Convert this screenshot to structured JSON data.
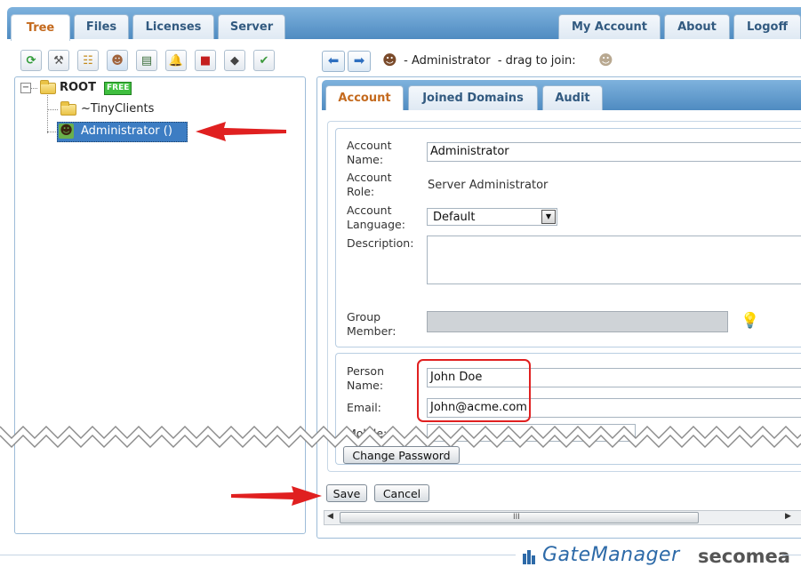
{
  "top_tabs": [
    "Tree",
    "Files",
    "Licenses",
    "Server"
  ],
  "account_tabs": [
    "My Account",
    "About",
    "Logoff"
  ],
  "toolbar_icons": [
    "refresh-icon",
    "wrench-icon",
    "hierarchy-icon",
    "user-icon",
    "certificate-icon",
    "bell-icon",
    "toolbox-icon",
    "eraser-icon",
    "check-icon"
  ],
  "tree": {
    "root_label": "ROOT",
    "root_badge": "FREE",
    "child_folder": "~TinyClients",
    "selected_item": "Administrator ()"
  },
  "breadcrumb": {
    "text": " - Administrator  - drag to join:"
  },
  "sub_tabs": [
    "Account",
    "Joined Domains",
    "Audit"
  ],
  "form": {
    "account_name_label": "Account Name:",
    "account_name_value": "Administrator",
    "account_role_label": "Account Role:",
    "account_role_value": "Server Administrator",
    "account_language_label": "Account Language:",
    "account_language_value": "Default",
    "description_label": "Description:",
    "description_value": "",
    "group_member_label": "Group Member:",
    "person_name_label": "Person Name:",
    "person_name_value": "John Doe",
    "email_label": "Email:",
    "email_value": "John@acme.com",
    "mobile_label": "Mobile:"
  },
  "buttons": {
    "change_password": "Change Password",
    "save": "Save",
    "cancel": "Cancel"
  },
  "scrollbar_grip": "III",
  "footer": {
    "brand": "GateManager",
    "company": "secomea"
  },
  "colors": {
    "header_blue": "#5d97ca",
    "active_tab_text": "#c46a1e",
    "highlight_red": "#e02020",
    "selection_blue": "#3d7dc3"
  }
}
